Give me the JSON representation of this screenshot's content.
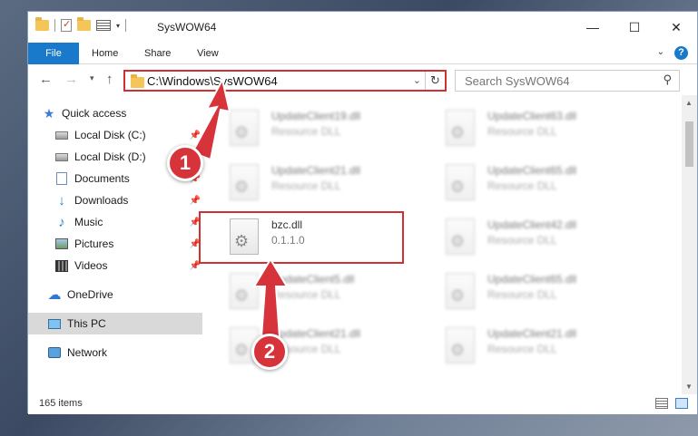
{
  "window": {
    "title": "SysWOW64",
    "controls": {
      "minimize": "—",
      "maximize": "☐",
      "close": "✕"
    }
  },
  "ribbon": {
    "tabs": [
      "File",
      "Home",
      "Share",
      "View"
    ],
    "help": "?"
  },
  "address": {
    "path": "C:\\Windows\\SysWOW64",
    "refresh_icon": "↻"
  },
  "search": {
    "placeholder": "Search SysWOW64"
  },
  "sidebar": {
    "items": [
      {
        "label": "Quick access",
        "icon": "star-icon"
      },
      {
        "label": "Local Disk (C:)",
        "icon": "drive-icon",
        "pinned": true
      },
      {
        "label": "Local Disk (D:)",
        "icon": "drive-icon",
        "pinned": true
      },
      {
        "label": "Documents",
        "icon": "documents-icon",
        "pinned": true
      },
      {
        "label": "Downloads",
        "icon": "download-icon",
        "pinned": true
      },
      {
        "label": "Music",
        "icon": "music-icon",
        "pinned": true
      },
      {
        "label": "Pictures",
        "icon": "pictures-icon",
        "pinned": true
      },
      {
        "label": "Videos",
        "icon": "videos-icon",
        "pinned": true
      },
      {
        "label": "OneDrive",
        "icon": "cloud-icon"
      },
      {
        "label": "This PC",
        "icon": "computer-icon",
        "selected": true
      },
      {
        "label": "Network",
        "icon": "network-icon"
      }
    ]
  },
  "files": [
    {
      "name": "UpdateClient19.dll",
      "desc": "Resource DLL"
    },
    {
      "name": "UpdateClient63.dll",
      "desc": "Resource DLL"
    },
    {
      "name": "UpdateClient21.dll",
      "desc": "Resource DLL"
    },
    {
      "name": "UpdateClient65.dll",
      "desc": "Resource DLL"
    },
    {
      "name": "bzc.dll",
      "desc": "0.1.1.0"
    },
    {
      "name": "UpdateClient42.dll",
      "desc": "Resource DLL"
    },
    {
      "name": "UpdateClient5.dll",
      "desc": "Resource DLL"
    },
    {
      "name": "UpdateClient65.dll",
      "desc": "Resource DLL"
    },
    {
      "name": "UpdateClient21.dll",
      "desc": "Resource DLL"
    },
    {
      "name": "UpdateClient21.dll",
      "desc": "Resource DLL"
    }
  ],
  "status": {
    "item_count": "165 items"
  },
  "annotations": {
    "step1": "1",
    "step2": "2",
    "color": "#d6333a"
  }
}
